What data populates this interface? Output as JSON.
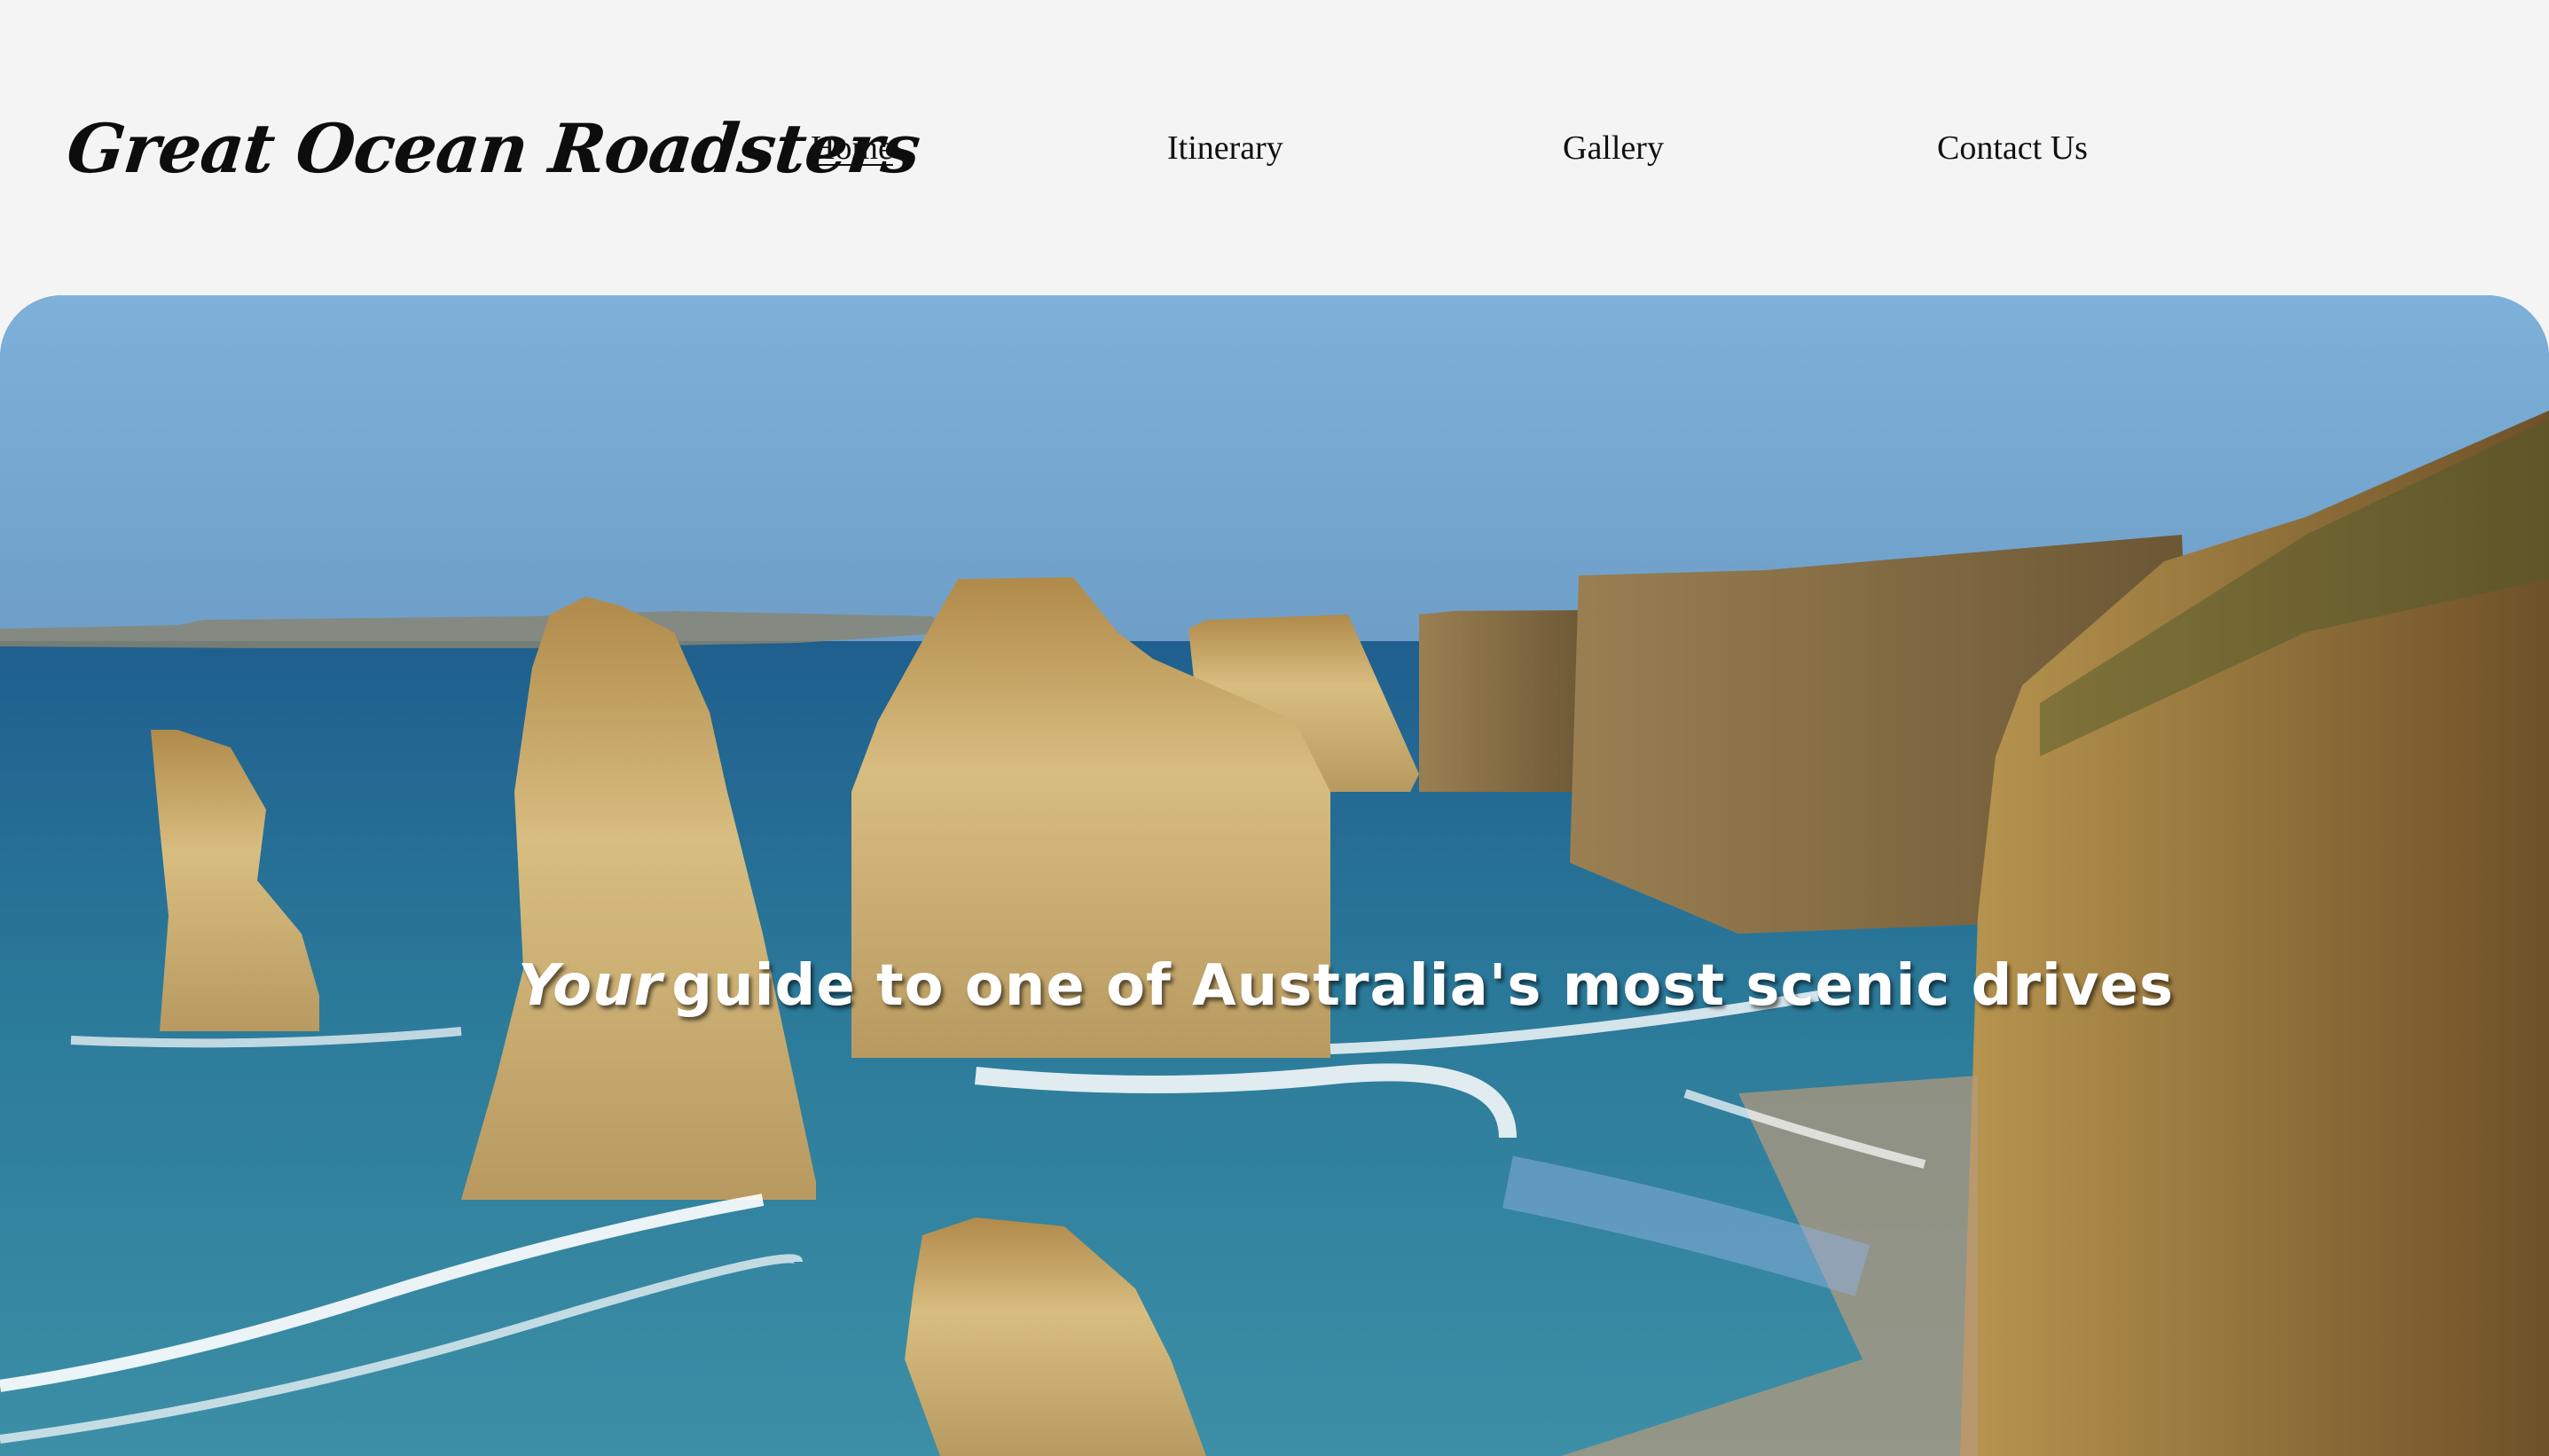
{
  "site": {
    "logo_text": "Great Ocean Roadsters"
  },
  "nav": {
    "items": [
      {
        "label": "Home",
        "active": true
      },
      {
        "label": "Itinerary",
        "active": false
      },
      {
        "label": "Gallery",
        "active": false
      },
      {
        "label": "Contact Us",
        "active": false
      }
    ]
  },
  "hero": {
    "heading_emphasis": "Your",
    "heading_rest": "guide to one of Australia's most scenic drives",
    "image_subject": "twelve-apostles-coastline-photo"
  },
  "colors": {
    "background": "#f4f4f4",
    "text": "#111111",
    "sky": "#7fb0d8",
    "ocean": "#2e7aa0",
    "rock": "#c9a964"
  }
}
